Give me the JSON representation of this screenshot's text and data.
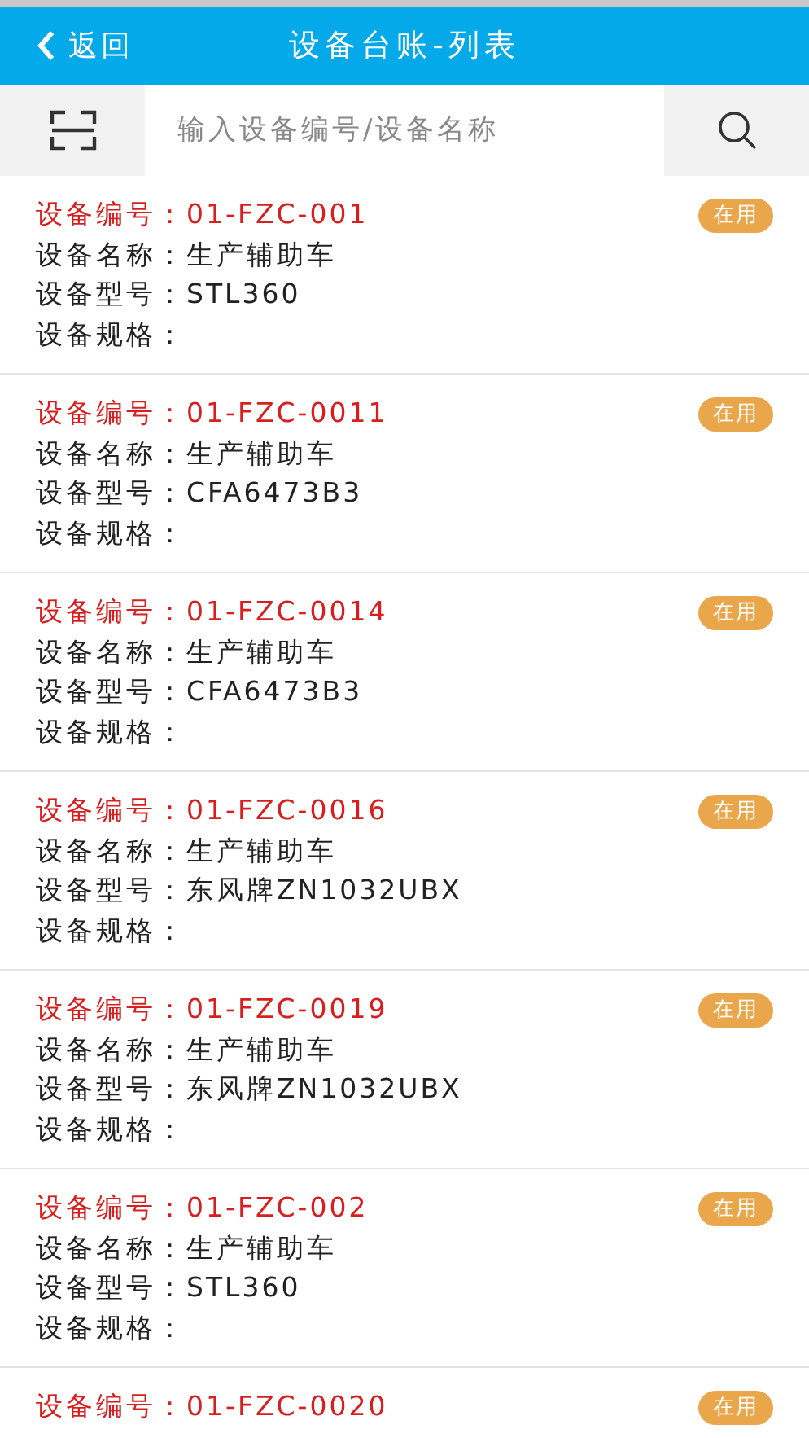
{
  "header": {
    "back": "返回",
    "title": "设备台账-列表"
  },
  "search": {
    "placeholder": "输入设备编号/设备名称"
  },
  "items": [
    {
      "code_label": "设备编号：",
      "code": "01-FZC-001",
      "status": "在用",
      "fields": [
        {
          "label": "设备名称：",
          "value": "生产辅助车"
        },
        {
          "label": "设备型号：",
          "value": "STL360"
        },
        {
          "label": "设备规格："
        }
      ]
    },
    {
      "code_label": "设备编号：",
      "code": "01-FZC-0011",
      "status": "在用",
      "fields": [
        {
          "label": "设备名称：",
          "value": "生产辅助车"
        },
        {
          "label": "设备型号：",
          "value": "CFA6473B3"
        },
        {
          "label": "设备规格："
        }
      ]
    },
    {
      "code_label": "设备编号：",
      "code": "01-FZC-0014",
      "status": "在用",
      "fields": [
        {
          "label": "设备名称：",
          "value": "生产辅助车"
        },
        {
          "label": "设备型号：",
          "value": "CFA6473B3"
        },
        {
          "label": "设备规格："
        }
      ]
    },
    {
      "code_label": "设备编号：",
      "code": "01-FZC-0016",
      "status": "在用",
      "fields": [
        {
          "label": "设备名称：",
          "value": "生产辅助车"
        },
        {
          "label": "设备型号：",
          "value": "东风牌ZN1032UBX"
        },
        {
          "label": "设备规格："
        }
      ]
    },
    {
      "code_label": "设备编号：",
      "code": "01-FZC-0019",
      "status": "在用",
      "fields": [
        {
          "label": "设备名称：",
          "value": "生产辅助车"
        },
        {
          "label": "设备型号：",
          "value": "东风牌ZN1032UBX"
        },
        {
          "label": "设备规格："
        }
      ]
    },
    {
      "code_label": "设备编号：",
      "code": "01-FZC-002",
      "status": "在用",
      "fields": [
        {
          "label": "设备名称：",
          "value": "生产辅助车"
        },
        {
          "label": "设备型号：",
          "value": "STL360"
        },
        {
          "label": "设备规格："
        }
      ]
    },
    {
      "code_label": "设备编号：",
      "code": "01-FZC-0020",
      "status": "在用"
    }
  ]
}
